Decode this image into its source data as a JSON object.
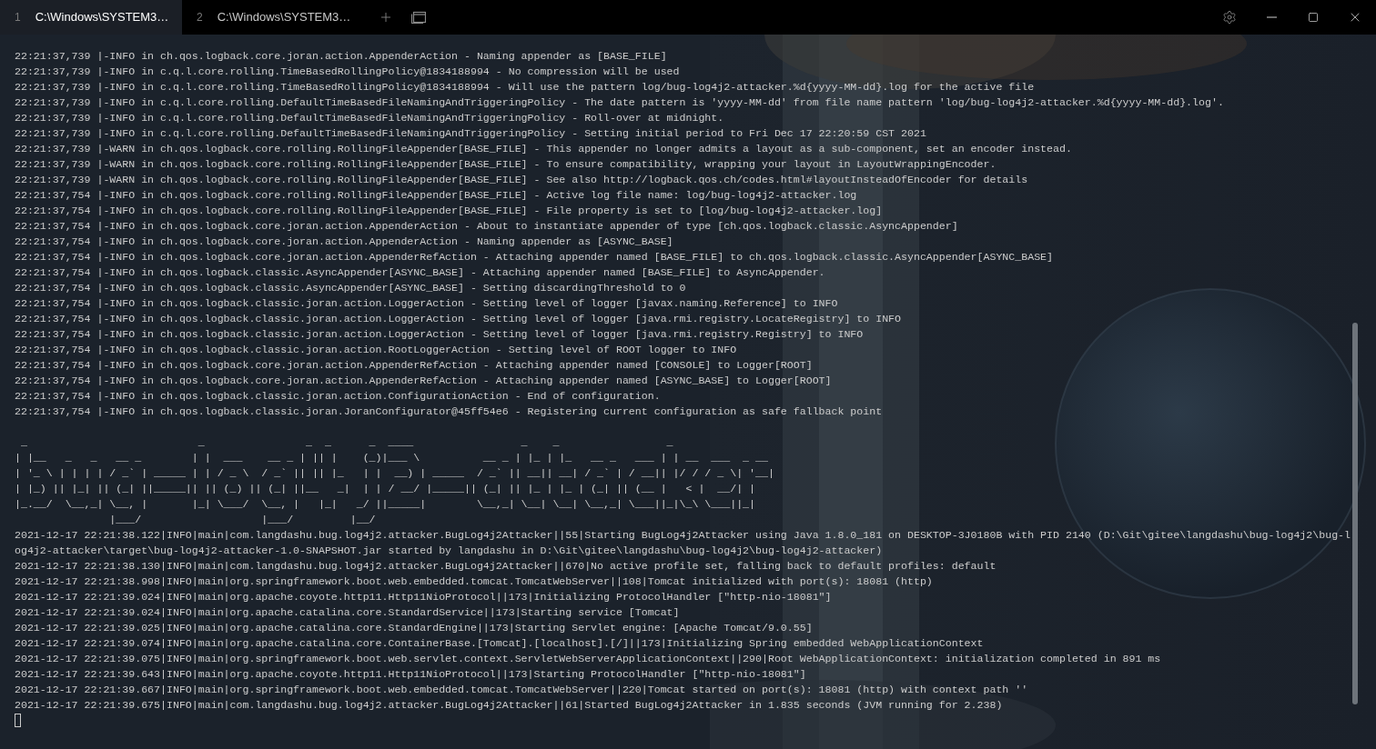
{
  "tabs": [
    {
      "number": "1",
      "title": "C:\\Windows\\SYSTEM3…",
      "selected": true
    },
    {
      "number": "2",
      "title": "C:\\Windows\\SYSTEM3…",
      "selected": false
    }
  ],
  "log_lines": [
    "22:21:37,739 |-INFO in ch.qos.logback.core.joran.action.AppenderAction - Naming appender as [BASE_FILE]",
    "22:21:37,739 |-INFO in c.q.l.core.rolling.TimeBasedRollingPolicy@1834188994 - No compression will be used",
    "22:21:37,739 |-INFO in c.q.l.core.rolling.TimeBasedRollingPolicy@1834188994 - Will use the pattern log/bug-log4j2-attacker.%d{yyyy-MM-dd}.log for the active file",
    "22:21:37,739 |-INFO in c.q.l.core.rolling.DefaultTimeBasedFileNamingAndTriggeringPolicy - The date pattern is 'yyyy-MM-dd' from file name pattern 'log/bug-log4j2-attacker.%d{yyyy-MM-dd}.log'.",
    "22:21:37,739 |-INFO in c.q.l.core.rolling.DefaultTimeBasedFileNamingAndTriggeringPolicy - Roll-over at midnight.",
    "22:21:37,739 |-INFO in c.q.l.core.rolling.DefaultTimeBasedFileNamingAndTriggeringPolicy - Setting initial period to Fri Dec 17 22:20:59 CST 2021",
    "22:21:37,739 |-WARN in ch.qos.logback.core.rolling.RollingFileAppender[BASE_FILE] - This appender no longer admits a layout as a sub-component, set an encoder instead.",
    "22:21:37,739 |-WARN in ch.qos.logback.core.rolling.RollingFileAppender[BASE_FILE] - To ensure compatibility, wrapping your layout in LayoutWrappingEncoder.",
    "22:21:37,739 |-WARN in ch.qos.logback.core.rolling.RollingFileAppender[BASE_FILE] - See also http://logback.qos.ch/codes.html#layoutInsteadOfEncoder for details",
    "22:21:37,754 |-INFO in ch.qos.logback.core.rolling.RollingFileAppender[BASE_FILE] - Active log file name: log/bug-log4j2-attacker.log",
    "22:21:37,754 |-INFO in ch.qos.logback.core.rolling.RollingFileAppender[BASE_FILE] - File property is set to [log/bug-log4j2-attacker.log]",
    "22:21:37,754 |-INFO in ch.qos.logback.core.joran.action.AppenderAction - About to instantiate appender of type [ch.qos.logback.classic.AsyncAppender]",
    "22:21:37,754 |-INFO in ch.qos.logback.core.joran.action.AppenderAction - Naming appender as [ASYNC_BASE]",
    "22:21:37,754 |-INFO in ch.qos.logback.core.joran.action.AppenderRefAction - Attaching appender named [BASE_FILE] to ch.qos.logback.classic.AsyncAppender[ASYNC_BASE]",
    "22:21:37,754 |-INFO in ch.qos.logback.classic.AsyncAppender[ASYNC_BASE] - Attaching appender named [BASE_FILE] to AsyncAppender.",
    "22:21:37,754 |-INFO in ch.qos.logback.classic.AsyncAppender[ASYNC_BASE] - Setting discardingThreshold to 0",
    "22:21:37,754 |-INFO in ch.qos.logback.classic.joran.action.LoggerAction - Setting level of logger [javax.naming.Reference] to INFO",
    "22:21:37,754 |-INFO in ch.qos.logback.classic.joran.action.LoggerAction - Setting level of logger [java.rmi.registry.LocateRegistry] to INFO",
    "22:21:37,754 |-INFO in ch.qos.logback.classic.joran.action.LoggerAction - Setting level of logger [java.rmi.registry.Registry] to INFO",
    "22:21:37,754 |-INFO in ch.qos.logback.classic.joran.action.RootLoggerAction - Setting level of ROOT logger to INFO",
    "22:21:37,754 |-INFO in ch.qos.logback.core.joran.action.AppenderRefAction - Attaching appender named [CONSOLE] to Logger[ROOT]",
    "22:21:37,754 |-INFO in ch.qos.logback.core.joran.action.AppenderRefAction - Attaching appender named [ASYNC_BASE] to Logger[ROOT]",
    "22:21:37,754 |-INFO in ch.qos.logback.classic.joran.action.ConfigurationAction - End of configuration.",
    "22:21:37,754 |-INFO in ch.qos.logback.classic.joran.JoranConfigurator@45ff54e6 - Registering current configuration as safe fallback point"
  ],
  "banner": [
    " _                           _                _  _      _  ____                 _    _                 _",
    "| |__   _   _   __ _        | |  ___    __ _ | || |    (_)|___ \\          __ _ | |_ | |_   __ _   ___ | | __  ___  _ __",
    "| '_ \\ | | | | / _` | _____ | | / _ \\  / _` || || |_   | |  __) | _____  / _` || __|| __| / _` | / __|| |/ / / _ \\| '__|",
    "| |_) || |_| || (_| ||_____|| || (_) || (_| ||__   _|  | | / __/ |_____|| (_| || |_ | |_ | (_| || (__ |   < |  __/| |",
    "|_.__/  \\__,_| \\__, |       |_| \\___/  \\__, |   |_|   _/ ||_____|        \\__,_| \\__| \\__| \\__,_| \\___||_|\\_\\ \\___||_|",
    "               |___/                   |___/         |__/"
  ],
  "app_lines": [
    "2021-12-17 22:21:38.122|INFO|main|com.langdashu.bug.log4j2.attacker.BugLog4j2Attacker||55|Starting BugLog4j2Attacker using Java 1.8.0_181 on DESKTOP-3J0180B with PID 2140 (D:\\Git\\gitee\\langdashu\\bug-log4j2\\bug-l",
    "og4j2-attacker\\target\\bug-log4j2-attacker-1.0-SNAPSHOT.jar started by langdashu in D:\\Git\\gitee\\langdashu\\bug-log4j2\\bug-log4j2-attacker)",
    "2021-12-17 22:21:38.130|INFO|main|com.langdashu.bug.log4j2.attacker.BugLog4j2Attacker||670|No active profile set, falling back to default profiles: default",
    "2021-12-17 22:21:38.998|INFO|main|org.springframework.boot.web.embedded.tomcat.TomcatWebServer||108|Tomcat initialized with port(s): 18081 (http)",
    "2021-12-17 22:21:39.024|INFO|main|org.apache.coyote.http11.Http11NioProtocol||173|Initializing ProtocolHandler [\"http-nio-18081\"]",
    "2021-12-17 22:21:39.024|INFO|main|org.apache.catalina.core.StandardService||173|Starting service [Tomcat]",
    "2021-12-17 22:21:39.025|INFO|main|org.apache.catalina.core.StandardEngine||173|Starting Servlet engine: [Apache Tomcat/9.0.55]",
    "2021-12-17 22:21:39.074|INFO|main|org.apache.catalina.core.ContainerBase.[Tomcat].[localhost].[/]||173|Initializing Spring embedded WebApplicationContext",
    "2021-12-17 22:21:39.075|INFO|main|org.springframework.boot.web.servlet.context.ServletWebServerApplicationContext||290|Root WebApplicationContext: initialization completed in 891 ms",
    "2021-12-17 22:21:39.643|INFO|main|org.apache.coyote.http11.Http11NioProtocol||173|Starting ProtocolHandler [\"http-nio-18081\"]",
    "2021-12-17 22:21:39.667|INFO|main|org.springframework.boot.web.embedded.tomcat.TomcatWebServer||220|Tomcat started on port(s): 18081 (http) with context path ''",
    "2021-12-17 22:21:39.675|INFO|main|com.langdashu.bug.log4j2.attacker.BugLog4j2Attacker||61|Started BugLog4j2Attacker in 1.835 seconds (JVM running for 2.238)"
  ]
}
